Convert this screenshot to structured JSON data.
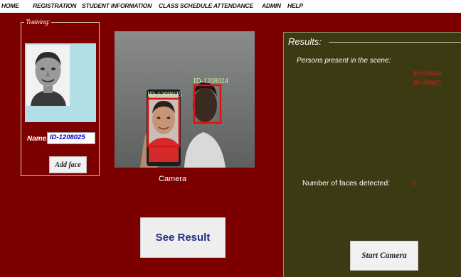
{
  "nav": {
    "items": [
      "HOME",
      "REGISTRATION",
      "STUDENT INFORMATION",
      "CLASS SCHEDULE",
      "ATTENDANCE",
      "ADMIN",
      "HELP"
    ]
  },
  "training": {
    "legend": "Training:",
    "name_label": "Name:",
    "name_value": "ID-1208025",
    "add_face_label": "Add face"
  },
  "camera": {
    "label": "Camera",
    "overlay_ids": [
      "ID-1208025",
      "ID-1208024"
    ]
  },
  "see_result_label": "See Result",
  "results": {
    "title": "Results:",
    "present_label": "Persons present in the scene:",
    "present_ids": [
      "ID-1208024",
      "ID-1208025"
    ],
    "faces_label": "Number of faces detected:",
    "faces_count": "2",
    "start_camera_label": "Start Camera"
  },
  "colors": {
    "main_bg": "#7d0000",
    "results_bg": "#3b3a12",
    "detect_box": "#e01010",
    "id_text": "#ff1a1a",
    "overlay_text": "#c8f7a8"
  }
}
